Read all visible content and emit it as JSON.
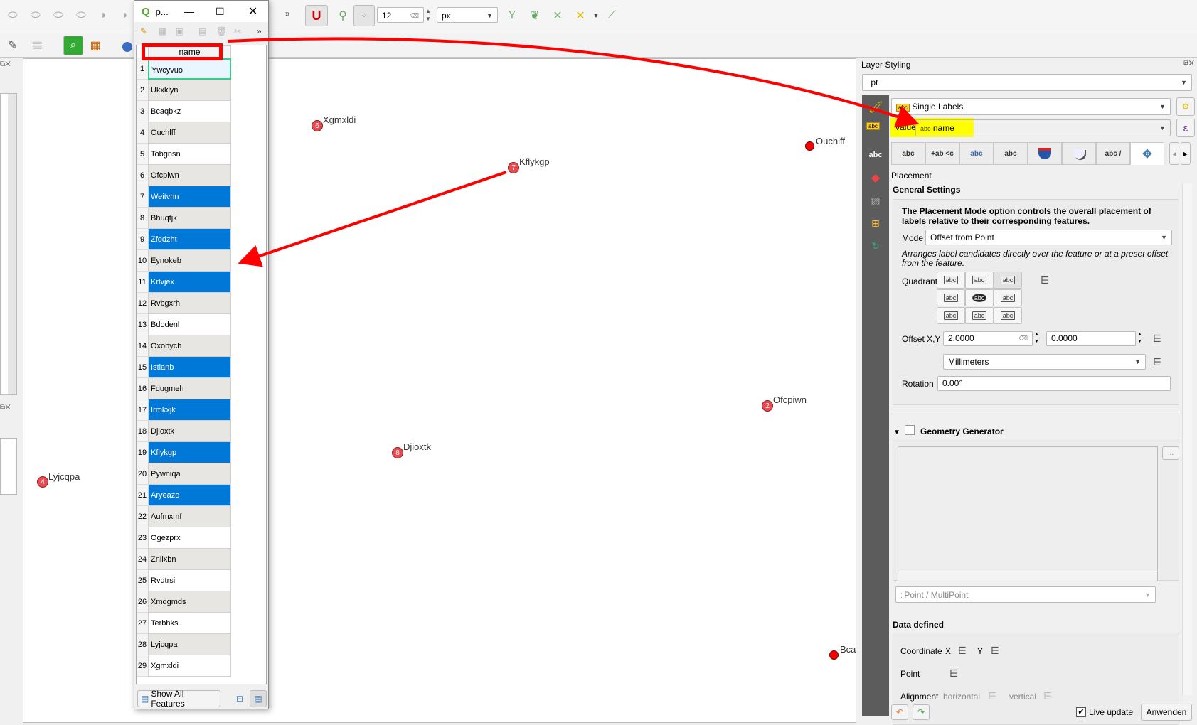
{
  "toolbar": {
    "snap_tolerance": "12",
    "snap_units": "px",
    "overflow_label": "»"
  },
  "attribute_table": {
    "window_title": "p...",
    "column_header": "name",
    "show_features_label": "Show All Features",
    "rows": [
      {
        "n": "1",
        "name": "Ywcyvuo",
        "state": "current"
      },
      {
        "n": "2",
        "name": "Ukxklyn",
        "state": "normal"
      },
      {
        "n": "3",
        "name": "Bcaqbkz",
        "state": "alt"
      },
      {
        "n": "4",
        "name": "Ouchlff",
        "state": "normal"
      },
      {
        "n": "5",
        "name": "Tobgnsn",
        "state": "alt"
      },
      {
        "n": "6",
        "name": "Ofcpiwn",
        "state": "normal"
      },
      {
        "n": "7",
        "name": "Weitvhn",
        "state": "selected"
      },
      {
        "n": "8",
        "name": "Bhuqtjk",
        "state": "normal"
      },
      {
        "n": "9",
        "name": "Zfqdzht",
        "state": "selected"
      },
      {
        "n": "10",
        "name": "Eynokeb",
        "state": "normal"
      },
      {
        "n": "11",
        "name": "Krlvjex",
        "state": "selected"
      },
      {
        "n": "12",
        "name": "Rvbgxrh",
        "state": "normal"
      },
      {
        "n": "13",
        "name": "Bdodenl",
        "state": "alt"
      },
      {
        "n": "14",
        "name": "Oxobych",
        "state": "normal"
      },
      {
        "n": "15",
        "name": "Istianb",
        "state": "selected"
      },
      {
        "n": "16",
        "name": "Fdugmeh",
        "state": "normal"
      },
      {
        "n": "17",
        "name": "Irmkxjk",
        "state": "selected"
      },
      {
        "n": "18",
        "name": "Djioxtk",
        "state": "normal"
      },
      {
        "n": "19",
        "name": "Kflykgp",
        "state": "selected"
      },
      {
        "n": "20",
        "name": "Pywniqa",
        "state": "normal"
      },
      {
        "n": "21",
        "name": "Aryeazo",
        "state": "selected"
      },
      {
        "n": "22",
        "name": "Aufmxmf",
        "state": "normal"
      },
      {
        "n": "23",
        "name": "Ogezprx",
        "state": "alt"
      },
      {
        "n": "24",
        "name": "Zniixbn",
        "state": "normal"
      },
      {
        "n": "25",
        "name": "Rvdtrsi",
        "state": "alt"
      },
      {
        "n": "26",
        "name": "Xmdgmds",
        "state": "normal"
      },
      {
        "n": "27",
        "name": "Terbhks",
        "state": "alt"
      },
      {
        "n": "28",
        "name": "Lyjcqpa",
        "state": "normal"
      },
      {
        "n": "29",
        "name": "Xgmxldi",
        "state": "alt"
      }
    ]
  },
  "map": {
    "points": [
      {
        "label": "Xgmxldi",
        "badge": "6"
      },
      {
        "label": "Kflykgp",
        "badge": "7"
      },
      {
        "label": "Ouchlff",
        "badge": ""
      },
      {
        "label": "Ofcpiwn",
        "badge": "2"
      },
      {
        "label": "Djioxtk",
        "badge": "8"
      },
      {
        "label": "Lyjcqpa",
        "badge": "4"
      },
      {
        "label": "Bca",
        "badge": ""
      }
    ]
  },
  "layer_styling": {
    "title": "Layer Styling",
    "layer": "pt",
    "renderer": "Single Labels",
    "value_label": "Value",
    "value_field": "name",
    "value_prefix": "abc",
    "section": "Placement",
    "general_settings": "General Settings",
    "description": "The Placement Mode option controls the overall placement of labels relative to their corresponding features.",
    "mode_label": "Mode",
    "mode_value": "Offset from Point",
    "mode_help": "Arranges label candidates directly over the feature or at a preset offset from the feature.",
    "quadrant_label": "Quadrant",
    "quadrant_cell": "abc",
    "offset_label": "Offset X,Y",
    "offset_x": "2.0000",
    "offset_y": "0.0000",
    "units": "Millimeters",
    "rotation_label": "Rotation",
    "rotation_value": "0.00°",
    "geometry_generator": "Geometry Generator",
    "geometry_type": "Point / MultiPoint",
    "ellipsis": "...",
    "data_defined": "Data defined",
    "coordinate_label": "Coordinate",
    "x_label": "X",
    "y_label": "Y",
    "point_label": "Point",
    "alignment_label": "Alignment",
    "horizontal_label": "horizontal",
    "vertical_label": "vertical",
    "live_update": "Live update",
    "apply": "Anwenden",
    "tab_labels": [
      "abc",
      "+ab <c",
      "abc",
      "abc",
      "",
      "",
      "abc /",
      ""
    ]
  }
}
